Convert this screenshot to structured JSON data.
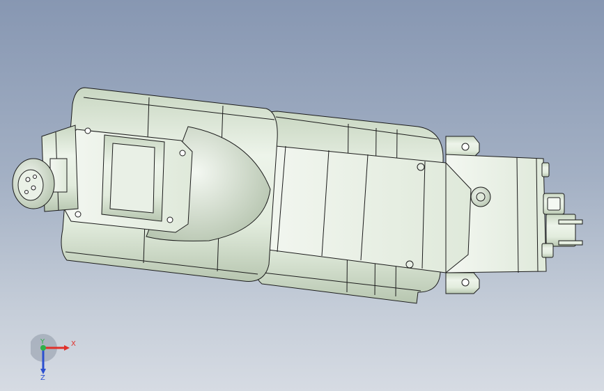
{
  "viewport": {
    "background_top": "#8797b2",
    "background_bottom": "#d6dbe3",
    "model_body_color": "#dfeadb",
    "model_shadow_color": "#b9c8b3",
    "edge_color": "#1a1a1a"
  },
  "triad": {
    "x_label": "X",
    "y_label": "Y",
    "z_label": "Z",
    "x_color": "#e0302a",
    "y_color": "#2fb04a",
    "z_color": "#2b4fd0"
  },
  "icons": [
    "view-triad-icon",
    "robot-arm-model"
  ]
}
